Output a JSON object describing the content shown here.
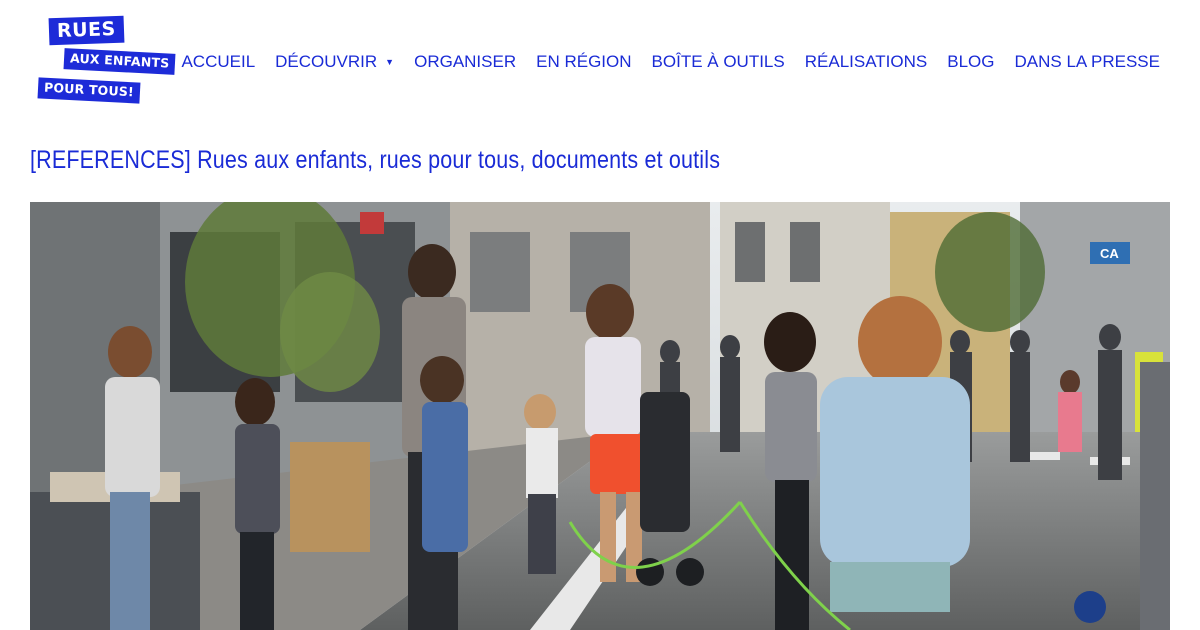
{
  "logo": {
    "line1": "RUES",
    "line2": "AUX ENFANTS",
    "line3": "POUR TOUS!",
    "color": "#1d2bd8"
  },
  "nav": {
    "items": [
      {
        "label": "ACCUEIL"
      },
      {
        "label": "DÉCOUVRIR"
      },
      {
        "label": "ORGANISER"
      },
      {
        "label": "EN RÉGION"
      },
      {
        "label": "BOÎTE À OUTILS"
      },
      {
        "label": "RÉALISATIONS"
      },
      {
        "label": "BLOG"
      },
      {
        "label": "DANS LA PRESSE"
      }
    ],
    "dropdown_icon": "caret-down-icon",
    "color": "#1a2bd6"
  },
  "page": {
    "title": "[REFERENCES] Rues aux enfants, rues pour tous, documents et outils"
  },
  "hero": {
    "icon": "street-photo",
    "shop_sign": "CA"
  }
}
